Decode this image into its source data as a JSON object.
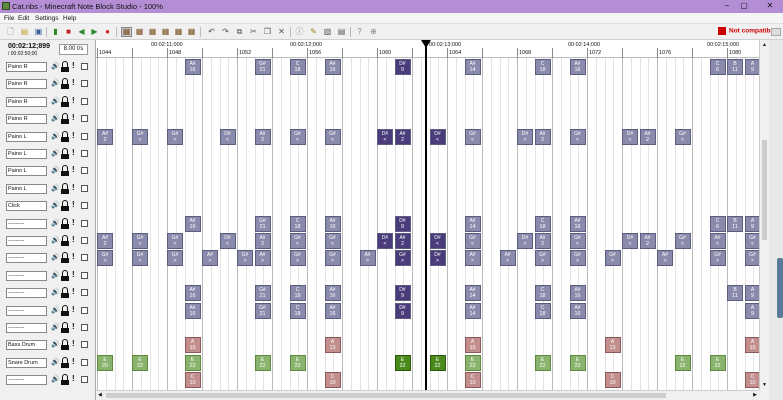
{
  "window": {
    "title": "Cat.nbs - Minecraft Note Block Studio - 100%",
    "minimize": "–",
    "maximize": "▢",
    "close": "✕"
  },
  "menu": [
    "File",
    "Edit",
    "Settings",
    "Help"
  ],
  "status": {
    "incompatible": "Not compatible"
  },
  "transport": {
    "time": "00:02:12;899",
    "total": "/ 00:02:50;00",
    "tempo": "8.00 t/s"
  },
  "ruler": {
    "times": [
      "00:02:11;000",
      "00:02:12;000",
      "00:02:13;000",
      "00:02:14;000",
      "00:02:15;000"
    ],
    "bars": [
      "1044",
      "1048",
      "1052",
      "1056",
      "1060",
      "1064",
      "1068",
      "1072",
      "1076",
      "1080"
    ]
  },
  "layers": [
    {
      "name": "Paino R"
    },
    {
      "name": "Paino R"
    },
    {
      "name": "Paino R"
    },
    {
      "name": "Paino R"
    },
    {
      "name": "Paino L"
    },
    {
      "name": "Paino L"
    },
    {
      "name": "Paino L"
    },
    {
      "name": "Paino L"
    },
    {
      "name": "Click"
    },
    {
      "name": "---------"
    },
    {
      "name": "---------"
    },
    {
      "name": "---------"
    },
    {
      "name": "---------"
    },
    {
      "name": "---------"
    },
    {
      "name": "---------"
    },
    {
      "name": "---------"
    },
    {
      "name": "Bass Drum"
    },
    {
      "name": "Snare Drum"
    },
    {
      "name": "---------"
    }
  ],
  "notes": [
    {
      "row": 0,
      "col": 10,
      "k": "A#",
      "n": "16",
      "c": "gray"
    },
    {
      "row": 0,
      "col": 18,
      "k": "G#",
      "n": "21",
      "c": "gray"
    },
    {
      "row": 0,
      "col": 22,
      "k": "C",
      "n": "18",
      "c": "gray"
    },
    {
      "row": 0,
      "col": 26,
      "k": "A#",
      "n": "16",
      "c": "gray"
    },
    {
      "row": 0,
      "col": 34,
      "k": "D#",
      "n": "9",
      "c": "purple"
    },
    {
      "row": 0,
      "col": 42,
      "k": "A#",
      "n": "14",
      "c": "gray"
    },
    {
      "row": 0,
      "col": 50,
      "k": "C",
      "n": "18",
      "c": "gray"
    },
    {
      "row": 0,
      "col": 54,
      "k": "A#",
      "n": "16",
      "c": "gray"
    },
    {
      "row": 0,
      "col": 70,
      "k": "C",
      "n": "6",
      "c": "gray"
    },
    {
      "row": 0,
      "col": 72,
      "k": "B",
      "n": "11",
      "c": "gray"
    },
    {
      "row": 0,
      "col": 74,
      "k": "A",
      "n": "9",
      "c": "gray"
    },
    {
      "row": 4,
      "col": 0,
      "k": "A#",
      "n": "2",
      "c": "gray"
    },
    {
      "row": 4,
      "col": 4,
      "k": "G#",
      "n": "<",
      "c": "gray"
    },
    {
      "row": 4,
      "col": 8,
      "k": "G#",
      "n": "<",
      "c": "gray"
    },
    {
      "row": 4,
      "col": 14,
      "k": "D#",
      "n": "<",
      "c": "gray"
    },
    {
      "row": 4,
      "col": 18,
      "k": "A#",
      "n": "2",
      "c": "gray"
    },
    {
      "row": 4,
      "col": 22,
      "k": "G#",
      "n": "<",
      "c": "gray"
    },
    {
      "row": 4,
      "col": 26,
      "k": "G#",
      "n": "<",
      "c": "gray"
    },
    {
      "row": 4,
      "col": 32,
      "k": "D#",
      "n": "<",
      "c": "purple"
    },
    {
      "row": 4,
      "col": 34,
      "k": "A#",
      "n": "2",
      "c": "purple"
    },
    {
      "row": 4,
      "col": 38,
      "k": "D#",
      "n": "<",
      "c": "purple"
    },
    {
      "row": 4,
      "col": 42,
      "k": "G#",
      "n": "<",
      "c": "gray"
    },
    {
      "row": 4,
      "col": 48,
      "k": "D#",
      "n": "<",
      "c": "gray"
    },
    {
      "row": 4,
      "col": 50,
      "k": "A#",
      "n": "2",
      "c": "gray"
    },
    {
      "row": 4,
      "col": 54,
      "k": "G#",
      "n": "<",
      "c": "gray"
    },
    {
      "row": 4,
      "col": 60,
      "k": "D#",
      "n": "<",
      "c": "gray"
    },
    {
      "row": 4,
      "col": 62,
      "k": "A#",
      "n": "2",
      "c": "gray"
    },
    {
      "row": 4,
      "col": 66,
      "k": "G#",
      "n": "<",
      "c": "gray"
    },
    {
      "row": 9,
      "col": 10,
      "k": "A#",
      "n": "16",
      "c": "gray"
    },
    {
      "row": 9,
      "col": 18,
      "k": "G#",
      "n": "21",
      "c": "gray"
    },
    {
      "row": 9,
      "col": 22,
      "k": "C",
      "n": "18",
      "c": "gray"
    },
    {
      "row": 9,
      "col": 26,
      "k": "A#",
      "n": "16",
      "c": "gray"
    },
    {
      "row": 9,
      "col": 34,
      "k": "D#",
      "n": "9",
      "c": "purple"
    },
    {
      "row": 9,
      "col": 42,
      "k": "A#",
      "n": "14",
      "c": "gray"
    },
    {
      "row": 9,
      "col": 50,
      "k": "C",
      "n": "18",
      "c": "gray"
    },
    {
      "row": 9,
      "col": 54,
      "k": "A#",
      "n": "16",
      "c": "gray"
    },
    {
      "row": 9,
      "col": 70,
      "k": "C",
      "n": "6",
      "c": "gray"
    },
    {
      "row": 9,
      "col": 72,
      "k": "B",
      "n": "11",
      "c": "gray"
    },
    {
      "row": 9,
      "col": 74,
      "k": "A",
      "n": "9",
      "c": "gray"
    },
    {
      "row": 10,
      "col": 0,
      "k": "A#",
      "n": "2",
      "c": "gray"
    },
    {
      "row": 10,
      "col": 4,
      "k": "G#",
      "n": "<",
      "c": "gray"
    },
    {
      "row": 10,
      "col": 8,
      "k": "G#",
      "n": "<",
      "c": "gray"
    },
    {
      "row": 10,
      "col": 14,
      "k": "D#",
      "n": "<",
      "c": "gray"
    },
    {
      "row": 10,
      "col": 18,
      "k": "A#",
      "n": "2",
      "c": "gray"
    },
    {
      "row": 10,
      "col": 22,
      "k": "G#",
      "n": "<",
      "c": "gray"
    },
    {
      "row": 10,
      "col": 26,
      "k": "G#",
      "n": "<",
      "c": "gray"
    },
    {
      "row": 10,
      "col": 32,
      "k": "D#",
      "n": "<",
      "c": "purple"
    },
    {
      "row": 10,
      "col": 34,
      "k": "A#",
      "n": "2",
      "c": "purple"
    },
    {
      "row": 10,
      "col": 38,
      "k": "D#",
      "n": "<",
      "c": "purple"
    },
    {
      "row": 10,
      "col": 42,
      "k": "G#",
      "n": "<",
      "c": "gray"
    },
    {
      "row": 10,
      "col": 48,
      "k": "D#",
      "n": "<",
      "c": "gray"
    },
    {
      "row": 10,
      "col": 50,
      "k": "A#",
      "n": "2",
      "c": "gray"
    },
    {
      "row": 10,
      "col": 54,
      "k": "G#",
      "n": "<",
      "c": "gray"
    },
    {
      "row": 10,
      "col": 60,
      "k": "D#",
      "n": "<",
      "c": "gray"
    },
    {
      "row": 10,
      "col": 62,
      "k": "A#",
      "n": "2",
      "c": "gray"
    },
    {
      "row": 10,
      "col": 66,
      "k": "G#",
      "n": "<",
      "c": "gray"
    },
    {
      "row": 10,
      "col": 70,
      "k": "A#",
      "n": "<",
      "c": "gray"
    },
    {
      "row": 10,
      "col": 74,
      "k": "G#",
      "n": "<",
      "c": "gray"
    },
    {
      "row": 11,
      "col": 0,
      "k": "G#",
      "n": ">",
      "c": "gray"
    },
    {
      "row": 11,
      "col": 4,
      "k": "G#",
      "n": ">",
      "c": "gray"
    },
    {
      "row": 11,
      "col": 8,
      "k": "G#",
      "n": ">",
      "c": "gray"
    },
    {
      "row": 11,
      "col": 12,
      "k": "A#",
      "n": ">",
      "c": "gray"
    },
    {
      "row": 11,
      "col": 16,
      "k": "G#",
      "n": ">",
      "c": "gray"
    },
    {
      "row": 11,
      "col": 18,
      "k": "A#",
      "n": ">",
      "c": "gray"
    },
    {
      "row": 11,
      "col": 22,
      "k": "G#",
      "n": ">",
      "c": "gray"
    },
    {
      "row": 11,
      "col": 26,
      "k": "G#",
      "n": ">",
      "c": "gray"
    },
    {
      "row": 11,
      "col": 30,
      "k": "A#",
      "n": ">",
      "c": "gray"
    },
    {
      "row": 11,
      "col": 34,
      "k": "G#",
      "n": ">",
      "c": "purple"
    },
    {
      "row": 11,
      "col": 38,
      "k": "D#",
      "n": ">",
      "c": "purple"
    },
    {
      "row": 11,
      "col": 42,
      "k": "A#",
      "n": ">",
      "c": "gray"
    },
    {
      "row": 11,
      "col": 46,
      "k": "A#",
      "n": ">",
      "c": "gray"
    },
    {
      "row": 11,
      "col": 50,
      "k": "G#",
      "n": ">",
      "c": "gray"
    },
    {
      "row": 11,
      "col": 54,
      "k": "G#",
      "n": ">",
      "c": "gray"
    },
    {
      "row": 11,
      "col": 58,
      "k": "G#",
      "n": ">",
      "c": "gray"
    },
    {
      "row": 11,
      "col": 64,
      "k": "A#",
      "n": ">",
      "c": "gray"
    },
    {
      "row": 11,
      "col": 70,
      "k": "G#",
      "n": ">",
      "c": "gray"
    },
    {
      "row": 11,
      "col": 74,
      "k": "G#",
      "n": ">",
      "c": "gray"
    },
    {
      "row": 13,
      "col": 10,
      "k": "A#",
      "n": "16",
      "c": "gray"
    },
    {
      "row": 13,
      "col": 18,
      "k": "G#",
      "n": "21",
      "c": "gray"
    },
    {
      "row": 13,
      "col": 22,
      "k": "C",
      "n": "18",
      "c": "gray"
    },
    {
      "row": 13,
      "col": 26,
      "k": "A#",
      "n": "16",
      "c": "gray"
    },
    {
      "row": 13,
      "col": 34,
      "k": "D#",
      "n": "9",
      "c": "purple"
    },
    {
      "row": 13,
      "col": 42,
      "k": "A#",
      "n": "14",
      "c": "gray"
    },
    {
      "row": 13,
      "col": 50,
      "k": "C",
      "n": "18",
      "c": "gray"
    },
    {
      "row": 13,
      "col": 54,
      "k": "A#",
      "n": "16",
      "c": "gray"
    },
    {
      "row": 13,
      "col": 72,
      "k": "B",
      "n": "11",
      "c": "gray"
    },
    {
      "row": 13,
      "col": 74,
      "k": "A",
      "n": "9",
      "c": "gray"
    },
    {
      "row": 14,
      "col": 10,
      "k": "A#",
      "n": "16",
      "c": "gray"
    },
    {
      "row": 14,
      "col": 18,
      "k": "G#",
      "n": "21",
      "c": "gray"
    },
    {
      "row": 14,
      "col": 22,
      "k": "C",
      "n": "18",
      "c": "gray"
    },
    {
      "row": 14,
      "col": 26,
      "k": "A#",
      "n": "16",
      "c": "gray"
    },
    {
      "row": 14,
      "col": 34,
      "k": "D#",
      "n": "9",
      "c": "purple"
    },
    {
      "row": 14,
      "col": 42,
      "k": "A#",
      "n": "14",
      "c": "gray"
    },
    {
      "row": 14,
      "col": 50,
      "k": "C",
      "n": "18",
      "c": "gray"
    },
    {
      "row": 14,
      "col": 54,
      "k": "A#",
      "n": "16",
      "c": "gray"
    },
    {
      "row": 14,
      "col": 74,
      "k": "A",
      "n": "9",
      "c": "gray"
    },
    {
      "row": 16,
      "col": 10,
      "k": "A",
      "n": "15",
      "c": "pink"
    },
    {
      "row": 16,
      "col": 26,
      "k": "A",
      "n": "13",
      "c": "pink"
    },
    {
      "row": 16,
      "col": 42,
      "k": "A",
      "n": "15",
      "c": "pink"
    },
    {
      "row": 16,
      "col": 58,
      "k": "A",
      "n": "13",
      "c": "pink"
    },
    {
      "row": 16,
      "col": 74,
      "k": "A",
      "n": "15",
      "c": "pink"
    },
    {
      "row": 17,
      "col": 0,
      "k": "E",
      "n": "20",
      "c": "green"
    },
    {
      "row": 17,
      "col": 4,
      "k": "E",
      "n": "22",
      "c": "green"
    },
    {
      "row": 17,
      "col": 10,
      "k": "E",
      "n": "22",
      "c": "green"
    },
    {
      "row": 17,
      "col": 18,
      "k": "E",
      "n": "22",
      "c": "green"
    },
    {
      "row": 17,
      "col": 22,
      "k": "E",
      "n": "22",
      "c": "green"
    },
    {
      "row": 17,
      "col": 34,
      "k": "E",
      "n": "22",
      "c": "dgreen"
    },
    {
      "row": 17,
      "col": 38,
      "k": "E",
      "n": "22",
      "c": "dgreen"
    },
    {
      "row": 17,
      "col": 42,
      "k": "E",
      "n": "22",
      "c": "green"
    },
    {
      "row": 17,
      "col": 50,
      "k": "E",
      "n": "22",
      "c": "green"
    },
    {
      "row": 17,
      "col": 54,
      "k": "E",
      "n": "22",
      "c": "green"
    },
    {
      "row": 17,
      "col": 66,
      "k": "E",
      "n": "22",
      "c": "green"
    },
    {
      "row": 17,
      "col": 70,
      "k": "E",
      "n": "22",
      "c": "green"
    },
    {
      "row": 18,
      "col": 10,
      "k": "C",
      "n": "10",
      "c": "pink"
    },
    {
      "row": 18,
      "col": 26,
      "k": "C",
      "n": "10",
      "c": "pink"
    },
    {
      "row": 18,
      "col": 42,
      "k": "C",
      "n": "10",
      "c": "pink"
    },
    {
      "row": 18,
      "col": 58,
      "k": "C",
      "n": "10",
      "c": "pink"
    },
    {
      "row": 18,
      "col": 74,
      "k": "C",
      "n": "10",
      "c": "pink"
    }
  ]
}
